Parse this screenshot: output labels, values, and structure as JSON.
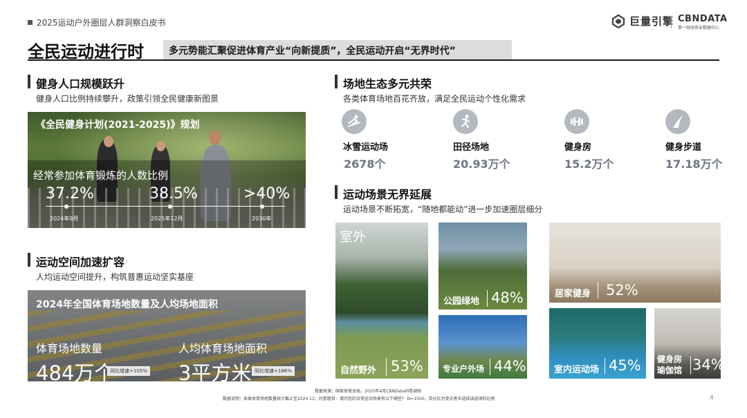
{
  "header": {
    "whitepaper_title": "2025运动户外圈层人群洞察白皮书",
    "logo_juliang": "巨量引擎",
    "logo_cbndata": "CBNDATA",
    "logo_cbndata_sub": "第一财经商业数据中心"
  },
  "title": {
    "main": "全民运动进行时",
    "subtitle": "多元势能汇聚促进体育产业“向新提质”，全民运动开启“无界时代”"
  },
  "section_fitness": {
    "title": "健身人口规模跃升",
    "subtitle": "健身人口比例持续攀升，政策引领全民健康新图景",
    "plan_title": "《全民健身计划(2021-2025)》规划",
    "stat_label": "经常参加体育锻炼的人数比例",
    "stats": [
      {
        "value": "37.2%",
        "date": "2024年9月"
      },
      {
        "value": "38.5%",
        "date": "2025年12月"
      },
      {
        "value": ">40%",
        "date": "2030年"
      }
    ]
  },
  "section_space": {
    "title": "运动空间加速扩容",
    "subtitle": "人均运动空间提升，构筑普惠运动坚实基座",
    "panel_title": "2024年全国体育场地数量及人均场地面积",
    "count_label": "体育场地数量",
    "count_value": "484万个",
    "count_yoy": "同比增速+105%",
    "area_label": "人均体育场地面积",
    "area_value": "3平方米",
    "area_yoy": "同比增速+186%"
  },
  "section_venues": {
    "title": "场地生态多元共荣",
    "subtitle": "各类体育场地百花齐放，满足全民运动个性化需求",
    "items": [
      {
        "name": "冰雪运动场",
        "value": "2678个",
        "icon": "skiing-icon"
      },
      {
        "name": "田径场地",
        "value": "20.93万个",
        "icon": "running-icon"
      },
      {
        "name": "健身房",
        "value": "15.2万个",
        "icon": "dumbbell-icon"
      },
      {
        "name": "健身步道",
        "value": "17.18万个",
        "icon": "trail-icon"
      }
    ]
  },
  "section_scenes": {
    "title": "运动场景无界延展",
    "subtitle": "运动场景不断拓宽，“随地都能动”进一步加速圈层细分",
    "outdoor_tag": "室外",
    "scenes": [
      {
        "name": "自然野外",
        "pct": "53%"
      },
      {
        "name": "公园绿地",
        "pct": "48%"
      },
      {
        "name": "专业户外场",
        "pct": "44%"
      },
      {
        "name": "居家健身",
        "pct": "52%"
      },
      {
        "name": "室内运动场",
        "pct": "45%"
      },
      {
        "name": "健身房",
        "name2": "瑜伽馆",
        "pct": "34%"
      }
    ]
  },
  "footer": {
    "source": "数据来源：国家体育总局，2025年4月CBNData问卷调研",
    "note": "数据说明：各类体育场地数量统计截止至2024.12；问卷题目：请问您的日常运动场景有以下哪些？ N=1500，百分比为受访者中选择该选项的比例",
    "page": "4"
  }
}
